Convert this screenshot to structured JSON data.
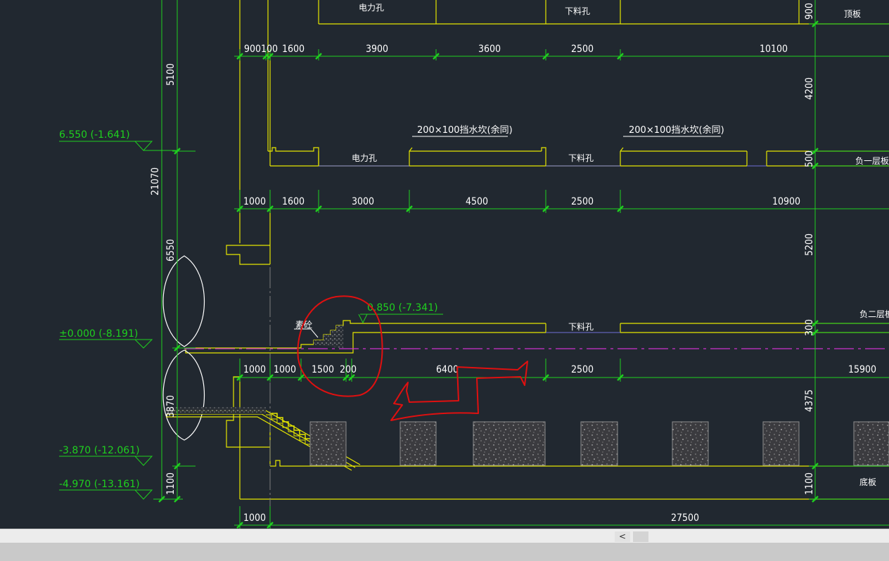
{
  "drawing": {
    "openings": {
      "roof_power": "电力孔",
      "roof_chute": "下料孔",
      "b1_power": "电力孔",
      "b1_chute": "下料孔",
      "b2_chute": "下料孔"
    },
    "slab_labels": {
      "roof": "顶板",
      "b1": "负一层板",
      "b2": "负二层板",
      "bottom": "底板"
    },
    "notes": {
      "ridge_a": "200×100挡水坎(余同)",
      "ridge_b": "200×100挡水坎(余同)",
      "step": "素砼"
    },
    "dims_top": [
      "900",
      "100",
      "1600",
      "3900",
      "3600",
      "2500",
      "10100"
    ],
    "dims_mid": [
      "1000",
      "1600",
      "3000",
      "4500",
      "2500",
      "10900"
    ],
    "dims_low": [
      "1000",
      "1000",
      "1500",
      "200",
      "6400",
      "2500",
      "15900"
    ],
    "dims_bottom": [
      "1000",
      "27500"
    ],
    "dims_left": {
      "h5100": "5100",
      "h21070": "21070",
      "h6550": "6550",
      "h3870": "3870",
      "h1100": "1100"
    },
    "dims_right": {
      "h900": "900",
      "h4200": "4200",
      "h500": "500",
      "h5200": "5200",
      "h300": "300",
      "h4375": "4375",
      "h1100": "1100"
    },
    "elevations": {
      "e1": "6.550 (-1.641)",
      "e2": "±0.000 (-8.191)",
      "e3": "-3.870 (-12.061)",
      "e4": "-4.970 (-13.161)",
      "e5": "0.850 (-7.341)"
    }
  },
  "ui": {
    "scroll_left": "<"
  },
  "colors": {
    "background": "#212830",
    "structure": "#e6e600",
    "dimension": "#1fd01f",
    "text": "#ffffff",
    "markup": "#e01010",
    "centerline": "#cc33cc"
  }
}
